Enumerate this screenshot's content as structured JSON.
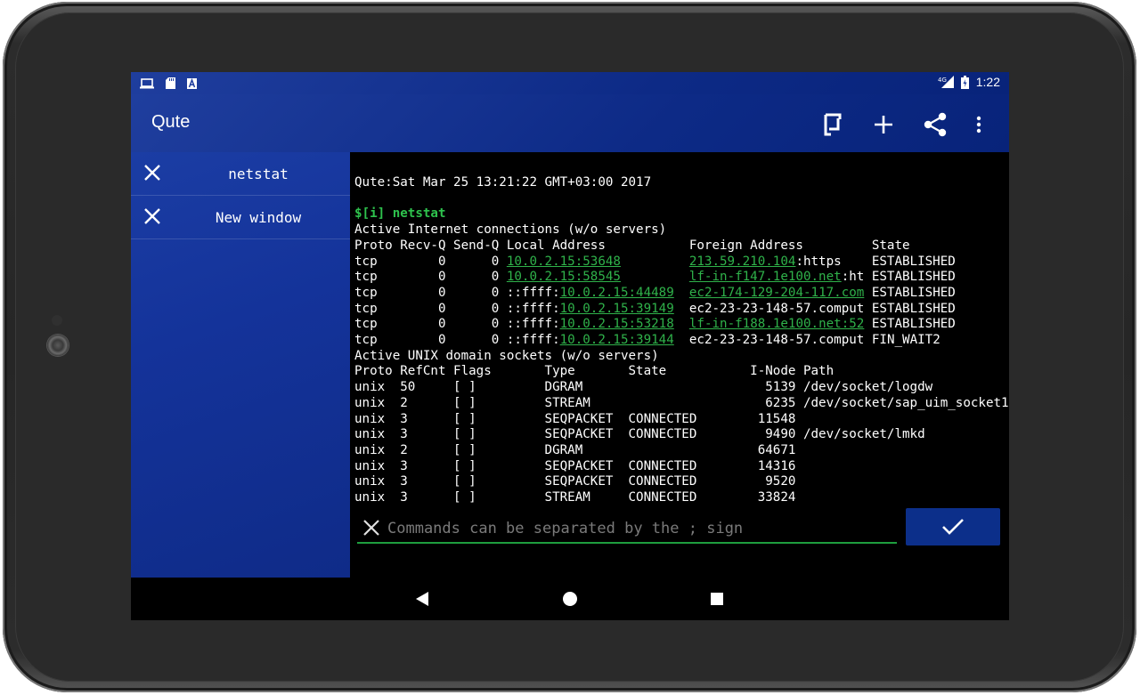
{
  "status_bar": {
    "network": "4G",
    "time": "1:22"
  },
  "app": {
    "title": "Qute"
  },
  "drawer": {
    "items": [
      {
        "label": "netstat"
      },
      {
        "label": "New window"
      }
    ]
  },
  "terminal": {
    "header": "Qute:Sat Mar 25 13:21:22 GMT+03:00 2017",
    "prompt": "$[i] netstat",
    "inet_title": "Active Internet connections (w/o servers)",
    "inet_columns": "Proto Recv-Q Send-Q Local Address           Foreign Address         State",
    "inet_rows": [
      {
        "pre": "tcp        0      0 ",
        "local_prefix": "",
        "local_link": "10.0.2.15:53648",
        "gap": "         ",
        "foreign_link": "213.59.210.104",
        "foreign_rest": ":https   ",
        "state": " ESTABLISHED"
      },
      {
        "pre": "tcp        0      0 ",
        "local_prefix": "",
        "local_link": "10.0.2.15:58545",
        "gap": "         ",
        "foreign_link": "lf-in-f147.1e100.net",
        "foreign_rest": ":ht",
        "state": " ESTABLISHED"
      },
      {
        "pre": "tcp        0      0 ",
        "local_prefix": "::ffff:",
        "local_link": "10.0.2.15:44489",
        "gap": "  ",
        "foreign_link": "ec2-174-129-204-117.com",
        "foreign_rest": "",
        "state": " ESTABLISHED"
      },
      {
        "pre": "tcp        0      0 ",
        "local_prefix": "::ffff:",
        "local_link": "10.0.2.15:39149",
        "gap": "  ",
        "foreign_link": "",
        "foreign_rest": "ec2-23-23-148-57.comput",
        "state": " ESTABLISHED"
      },
      {
        "pre": "tcp        0      0 ",
        "local_prefix": "::ffff:",
        "local_link": "10.0.2.15:53218",
        "gap": "  ",
        "foreign_link": "lf-in-f188.1e100.net:52",
        "foreign_rest": "",
        "state": " ESTABLISHED"
      },
      {
        "pre": "tcp        0      0 ",
        "local_prefix": "::ffff:",
        "local_link": "10.0.2.15:39144",
        "gap": "  ",
        "foreign_link": "",
        "foreign_rest": "ec2-23-23-148-57.comput",
        "state": " FIN_WAIT2"
      }
    ],
    "unix_title": "Active UNIX domain sockets (w/o servers)",
    "unix_columns": "Proto RefCnt Flags       Type       State           I-Node Path",
    "unix_rows": [
      "unix  50     [ ]         DGRAM                        5139 /dev/socket/logdw",
      "unix  2      [ ]         STREAM                       6235 /dev/socket/sap_uim_socket1",
      "unix  3      [ ]         SEQPACKET  CONNECTED        11548",
      "unix  3      [ ]         SEQPACKET  CONNECTED         9490 /dev/socket/lmkd",
      "unix  2      [ ]         DGRAM                       64671",
      "unix  3      [ ]         SEQPACKET  CONNECTED        14316",
      "unix  3      [ ]         SEQPACKET  CONNECTED         9520",
      "unix  3      [ ]         STREAM     CONNECTED        33824"
    ]
  },
  "command": {
    "placeholder": "Commands can be separated by the ; sign",
    "value": ""
  },
  "colors": {
    "appbar": "#1f3e9e",
    "link": "#2fb24a",
    "prompt": "#2ec24d",
    "ok_button": "#0c2f8a"
  }
}
